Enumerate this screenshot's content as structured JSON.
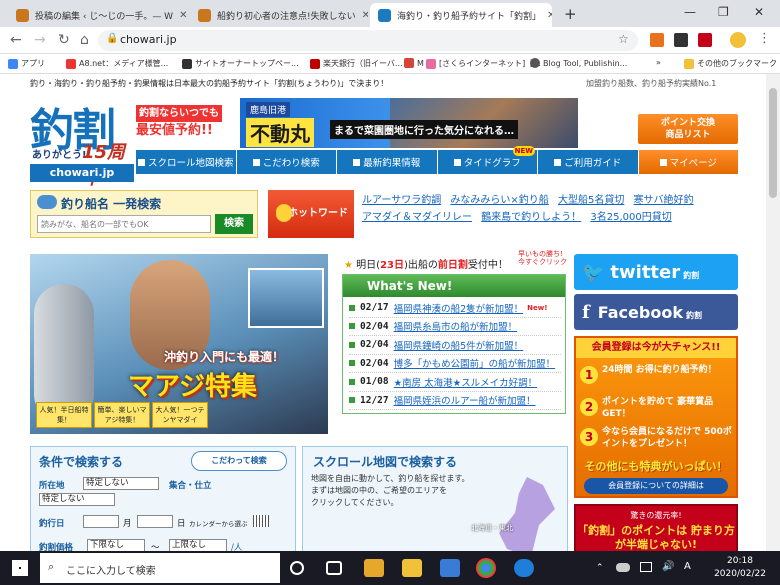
{
  "browser": {
    "tabs": [
      {
        "title": "投稿の編集 ‹ じ～じの一手。— W",
        "icon_color": "#c8771e"
      },
      {
        "title": "船釣り初心者の注意点!失敗しない",
        "icon_color": "#c8771e"
      },
      {
        "title": "海釣り・釣り船予約サイト「釣割」",
        "icon_color": "#1a7bc0"
      }
    ],
    "new_tab": "+",
    "url": "chowari.jp",
    "window_controls": [
      "—",
      "❐",
      "✕"
    ]
  },
  "bookmarks": [
    {
      "label": "アプリ"
    },
    {
      "label": "A8.net：メディア様管..."
    },
    {
      "label": "サイトオーナートップペー..."
    },
    {
      "label": "楽天銀行（旧イーバ..."
    },
    {
      "label": "M"
    },
    {
      "label": "[さくらインターネット]【..."
    },
    {
      "label": "Blog Tool, Publishin..."
    },
    {
      "label": "»"
    },
    {
      "label": "その他のブックマーク"
    }
  ],
  "site": {
    "tagline": "釣り・海釣り・釣り船予約・釣果情報は日本最大の釣船予約サイト「釣割(ちょうわり)」で決まり！",
    "top_right": "加盟釣り船数、釣り船予約実績No.1",
    "logo": {
      "main": "釣割",
      "sub": "ありがとう!",
      "years": "15周年",
      "domain": "chowari.jp"
    },
    "promo": [
      "釣割ならいつでも",
      "最安値予約!!"
    ],
    "banner": {
      "place": "鹿島旧港",
      "boat": "不動丸",
      "caption": "まるで菜園圏地に行った気分になれる…"
    },
    "point_button": [
      "ポイント交換",
      "商品リスト"
    ],
    "nav": [
      "スクロール地図検索",
      "こだわり検索",
      "最新釣果情報",
      "タイドグラフ",
      "ご利用ガイド",
      "マイページ"
    ],
    "nav_new_badge": "NEW",
    "search": {
      "title": "釣り船名 一発検索",
      "placeholder": "読みがな、船名の一部でもOK",
      "button": "検索"
    },
    "hotword_button": "ホットワード",
    "hotwords": [
      "ルアーサワラ釣調",
      "みなみみらい×釣り船",
      "大型船5名貸切",
      "寒サバ絶好釣",
      "アマダイ＆マダイリレー",
      "鶴来島で釣りしよう！",
      "3名25,000円貸切"
    ],
    "feature": {
      "line1": "沖釣り入門にも最適！",
      "line2": "マアジ特集",
      "tags": [
        "人気！半日船特集！",
        "簡単、楽しいマアジ特集！",
        "大人気！一つテンヤマダイ"
      ]
    },
    "tomorrow": {
      "pre": "明日(",
      "day": "23日",
      "mid": ")出船の",
      "highlight": "前日割",
      "post": "受付中！",
      "ad": "早いもの勝ち! 今すぐクリック"
    },
    "news": {
      "title": "What's New!",
      "items": [
        {
          "date": "02/17",
          "text": "福岡県神湊の船2隻が新加盟！",
          "new": "New!"
        },
        {
          "date": "02/04",
          "text": "福岡県糸島市の船が新加盟！",
          "new": ""
        },
        {
          "date": "02/04",
          "text": "福岡県鐘崎の船5件が新加盟！",
          "new": ""
        },
        {
          "date": "02/04",
          "text": "博多「かもめ公園前」の船が新加盟！",
          "new": ""
        },
        {
          "date": "01/08",
          "text": "★南房 太海港★スルメイカ好調！",
          "new": ""
        },
        {
          "date": "12/27",
          "text": "福岡県姪浜のルアー船が新加盟！",
          "new": ""
        }
      ]
    },
    "social": {
      "twitter": "twitter",
      "twitter_sub": "釣割",
      "facebook": "Facebook",
      "facebook_sub": "釣割"
    },
    "member": {
      "header": "会員登録は今が大チャンス!!",
      "items": [
        {
          "num": "1",
          "text": "24時間 お得に釣り船予約！"
        },
        {
          "num": "2",
          "text": "ポイントを貯めて 豪華賞品GET！"
        },
        {
          "num": "3",
          "text": "今なら会員になるだけで 500ポイントをプレゼント！"
        }
      ],
      "footer": "その他にも特典がいっぱい！",
      "button": "会員登録についての詳細は"
    },
    "cond": {
      "title": "条件で検索する",
      "kodawari": "こだわって検索",
      "loc_label": "所在地",
      "loc_value": "特定しない",
      "meet_label": "集合・仕立",
      "meet_value": "特定しない",
      "date_label": "釣行日",
      "month_unit": "月",
      "day_unit": "日",
      "calendar": "カレンダーから選ぶ",
      "price_label": "釣割価格",
      "price_min": "下限なし",
      "tilde": "〜",
      "price_max": "上限なし",
      "per_person": "/人"
    },
    "map": {
      "title": "スクロール地図で検索する",
      "desc": [
        "地図を自由に動かして、釣り船を探せます。",
        "まずは地図の中の、ご希望のエリアを",
        "クリックしてください。"
      ],
      "label": "北海道・東北"
    },
    "right_ad": {
      "line1": "驚きの還元率!",
      "line2": "「釣割」のポイントは 貯まり方が半端じゃない!"
    }
  },
  "taskbar": {
    "search_placeholder": "ここに入力して検索",
    "time": "20:18",
    "date": "2020/02/22"
  }
}
